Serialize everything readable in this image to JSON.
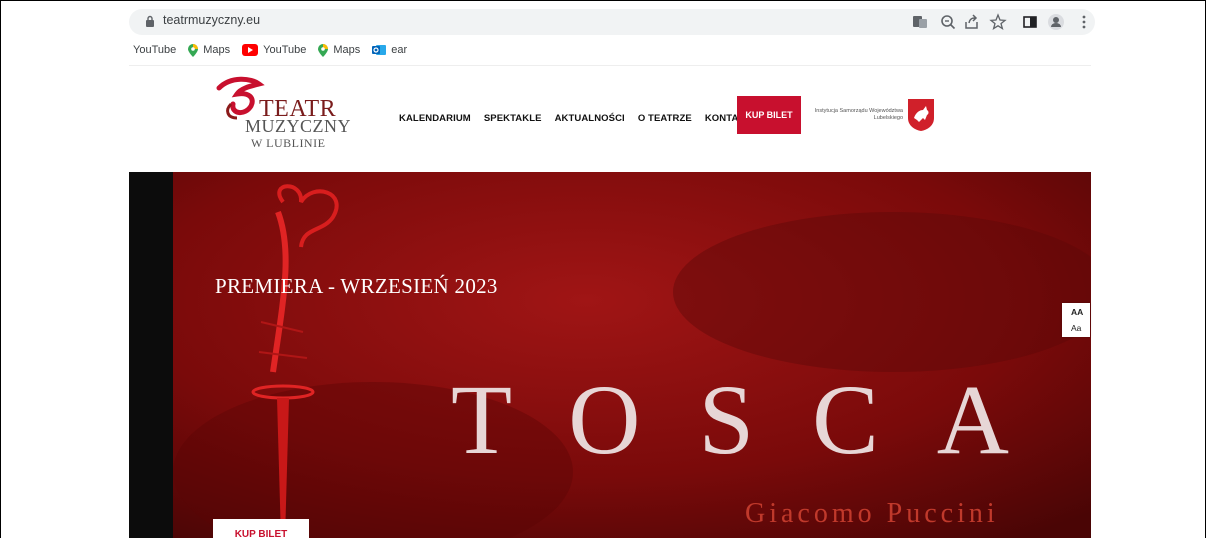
{
  "browser": {
    "url": "teatrmuzyczny.eu",
    "bookmarks": [
      {
        "label": "YouTube",
        "icon": "none"
      },
      {
        "label": "Maps",
        "icon": "maps-pin-icon"
      },
      {
        "label": "YouTube",
        "icon": "youtube-icon"
      },
      {
        "label": "Maps",
        "icon": "maps-pin-icon"
      },
      {
        "label": "ear",
        "icon": "outlook-icon"
      }
    ]
  },
  "site": {
    "logo": {
      "line1": "TEATR",
      "line2": "MUZYCZNY",
      "line3": "W LUBLINIE"
    },
    "nav": [
      "KALENDARIUM",
      "SPEKTAKLE",
      "AKTUALNOŚCI",
      "O TEATRZE",
      "KONTAKT"
    ],
    "buy_ticket": "KUP BILET",
    "institution": "Instytucja Samorządu Województwa Lubelskiego"
  },
  "hero": {
    "premiere": "PREMIERA - WRZESIEŃ 2023",
    "title": "TOSCA",
    "composer": "Giacomo Puccini",
    "buy_ticket": "KUP BILET"
  },
  "font_widget": {
    "large": "AA",
    "small": "Aa"
  },
  "colors": {
    "brand_red": "#c8102e",
    "hero_red": "#7e0a0a",
    "chrome_bg": "#f1f3f4"
  }
}
